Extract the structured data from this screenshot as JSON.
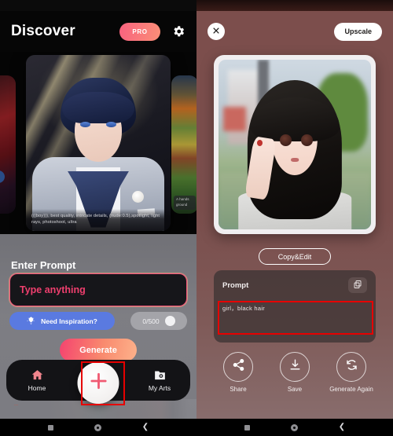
{
  "left_panel": {
    "header": {
      "title": "Discover",
      "pro_label": "PRO",
      "settings_icon": "gear-icon"
    },
    "carousel": {
      "center_card": {
        "caption": "(((boy))), best quality, intricate details, (nude:0.5),spotlight, light rays, photoshoot, ultra",
        "alt": "anime boy with navy blue hair in grey suit and navy scarf"
      },
      "left_card": {
        "alt": "dark red fantasy character artwork"
      },
      "right_card": {
        "caption": "A hands\nground",
        "alt": "colorful sunset landscape with fields"
      }
    },
    "prompt_section": {
      "label": "Enter Prompt",
      "input_placeholder": "Type anything",
      "input_value": "",
      "inspiration_label": "Need Inspiration?",
      "inspiration_icon": "lightbulb-icon",
      "counter": "0/500",
      "clear_icon": "clear-x-icon"
    },
    "generate_label": "Generate",
    "tabbar": {
      "items": [
        {
          "label": "Home",
          "icon": "home-icon"
        },
        {
          "label": "My Arts",
          "icon": "photo-folder-icon"
        }
      ],
      "fab_icon": "plus-icon"
    },
    "behind_text": "...",
    "navbar": {
      "recent_icon": "square-icon",
      "home_icon": "circle-icon",
      "back_icon": "back-chevron-icon"
    }
  },
  "right_panel": {
    "header": {
      "close_icon": "close-x-icon",
      "upscale_label": "Upscale"
    },
    "result_image": {
      "alt": "anime girl with long black hair in grey sweater on blurred street"
    },
    "copy_edit_label": "Copy&Edit",
    "prompt_panel": {
      "title": "Prompt",
      "copy_icon": "copy-icon",
      "text": "girl，black hair"
    },
    "actions": [
      {
        "label": "Share",
        "icon": "share-icon"
      },
      {
        "label": "Save",
        "icon": "download-icon"
      },
      {
        "label": "Generate\nAgain",
        "icon": "refresh-icon"
      }
    ],
    "navbar": {
      "recent_icon": "square-icon",
      "home_icon": "circle-icon",
      "back_icon": "back-chevron-icon"
    }
  },
  "annotations": {
    "fab_highlight": "plus-button-highlight",
    "prompt_highlight": "prompt-text-highlight"
  },
  "colors": {
    "accent_pink": "#f4436f",
    "pro_gradient_start": "#f8627f",
    "inspire_blue": "#5a7ae0",
    "right_bg": "#7c4e4c",
    "annotation_red": "#e60000"
  }
}
